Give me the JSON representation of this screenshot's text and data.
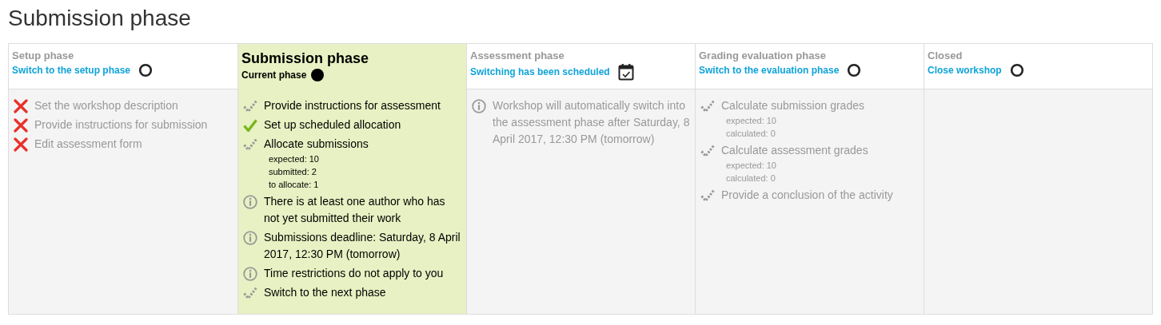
{
  "page_title": "Submission phase",
  "phases": [
    {
      "title": "Setup phase",
      "current": false,
      "action": {
        "kind": "link",
        "label": "Switch to the setup phase"
      },
      "indicator": {
        "kind": "circle"
      },
      "tasks": [
        {
          "kind": "fail",
          "text": "Set the workshop description"
        },
        {
          "kind": "fail",
          "text": "Provide instructions for submission"
        },
        {
          "kind": "fail",
          "text": "Edit assessment form"
        }
      ]
    },
    {
      "title": "Submission phase",
      "current": true,
      "action": {
        "kind": "status",
        "label": "Current phase"
      },
      "indicator": {
        "kind": "dot"
      },
      "tasks": [
        {
          "kind": "todo",
          "text": "Provide instructions for assessment"
        },
        {
          "kind": "done",
          "text": "Set up scheduled allocation"
        },
        {
          "kind": "todo",
          "text": "Allocate submissions",
          "details": [
            "expected: 10",
            "submitted: 2",
            "to allocate: 1"
          ]
        },
        {
          "kind": "info",
          "text": "There is at least one author who has not yet submitted their work"
        },
        {
          "kind": "info",
          "text": "Submissions deadline: Saturday, 8 April 2017, 12:30 PM (tomorrow)"
        },
        {
          "kind": "info",
          "text": "Time restrictions do not apply to you"
        },
        {
          "kind": "todo",
          "text": "Switch to the next phase"
        }
      ]
    },
    {
      "title": "Assessment phase",
      "current": false,
      "action": {
        "kind": "link",
        "label": "Switching has been scheduled"
      },
      "indicator": {
        "kind": "calendar"
      },
      "tasks": [
        {
          "kind": "info",
          "text": "Workshop will automatically switch into the assessment phase after Saturday, 8 April 2017, 12:30 PM (tomorrow)"
        }
      ]
    },
    {
      "title": "Grading evaluation phase",
      "current": false,
      "action": {
        "kind": "link",
        "label": "Switch to the evaluation phase"
      },
      "indicator": {
        "kind": "circle"
      },
      "tasks": [
        {
          "kind": "todo",
          "text": "Calculate submission grades",
          "details": [
            "expected: 10",
            "calculated: 0"
          ]
        },
        {
          "kind": "todo",
          "text": "Calculate assessment grades",
          "details": [
            "expected: 10",
            "calculated: 0"
          ]
        },
        {
          "kind": "todo",
          "text": "Provide a conclusion of the activity"
        }
      ]
    },
    {
      "title": "Closed",
      "current": false,
      "action": {
        "kind": "link",
        "label": "Close workshop"
      },
      "indicator": {
        "kind": "circle"
      }
    }
  ]
}
